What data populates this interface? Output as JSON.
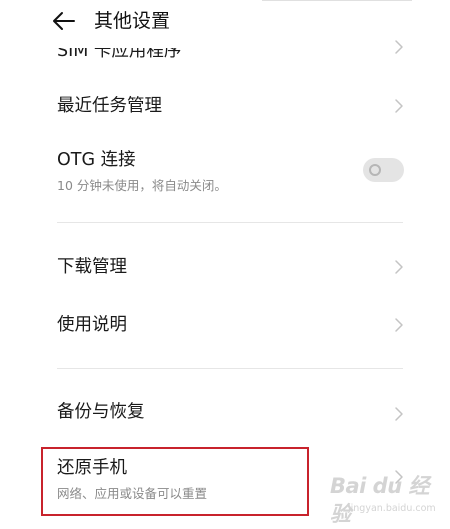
{
  "header": {
    "title": "其他设置",
    "back_icon": "arrow-left-icon"
  },
  "items": {
    "sim_apps": {
      "label": "SIM 卡应用程序"
    },
    "recent_tasks": {
      "label": "最近任务管理"
    },
    "otg": {
      "label": "OTG 连接",
      "subtitle": "10 分钟未使用，将自动关闭。",
      "toggle_on": false
    },
    "download": {
      "label": "下载管理"
    },
    "manual": {
      "label": "使用说明"
    },
    "backup": {
      "label": "备份与恢复"
    },
    "reset": {
      "label": "还原手机",
      "subtitle": "网络、应用或设备可以重置"
    }
  },
  "watermark": {
    "logo": "Bai du 经验",
    "site": "jingyan.baidu.com"
  },
  "colors": {
    "highlight": "#c8232c",
    "divider": "#e6e6e6",
    "subtitle": "#8a8a8a",
    "toggle_track": "#e4e4e4"
  }
}
